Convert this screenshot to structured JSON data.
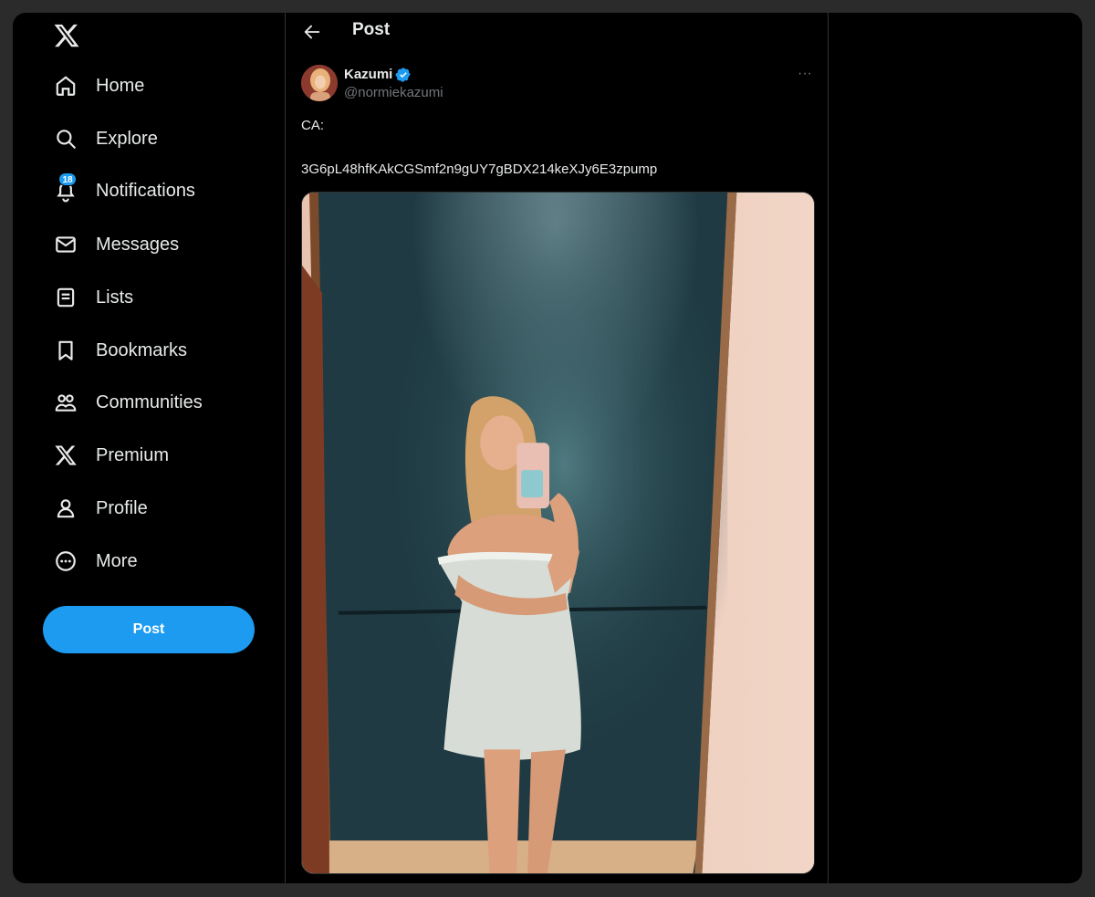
{
  "sidebar": {
    "logo_icon": "x-logo-icon",
    "items": [
      {
        "label": "Home",
        "icon": "home-icon"
      },
      {
        "label": "Explore",
        "icon": "search-icon"
      },
      {
        "label": "Notifications",
        "icon": "bell-icon",
        "badge": "18"
      },
      {
        "label": "Messages",
        "icon": "mail-icon"
      },
      {
        "label": "Lists",
        "icon": "list-icon"
      },
      {
        "label": "Bookmarks",
        "icon": "bookmark-icon"
      },
      {
        "label": "Communities",
        "icon": "communities-icon"
      },
      {
        "label": "Premium",
        "icon": "x-logo-icon"
      },
      {
        "label": "Profile",
        "icon": "person-icon"
      },
      {
        "label": "More",
        "icon": "more-circle-icon"
      }
    ],
    "post_button_label": "Post"
  },
  "header": {
    "title": "Post"
  },
  "post": {
    "author_name": "Kazumi",
    "author_handle": "@normiekazumi",
    "verified": true,
    "text_line1": "CA:",
    "text_line2": "3G6pL48hfKAkCGSmf2n9gUY7gBDX214keXJy6E3zpump",
    "more_label": "···"
  },
  "colors": {
    "accent": "#1d9bf0",
    "background": "#000000",
    "text": "#e7e9ea",
    "muted": "#71767b",
    "border": "#2f3336"
  }
}
